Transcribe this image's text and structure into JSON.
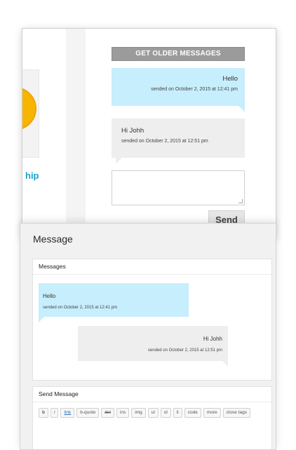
{
  "frontend": {
    "widget_link": "hip",
    "older_button": "GET OLDER MESSAGES",
    "messages": [
      {
        "text": "Hello",
        "meta": "sended on October 2, 2015 at 12:41 pm"
      },
      {
        "text": "Hi Johh",
        "meta": "sended on October 2, 2015 at 12:51 pm"
      }
    ],
    "send_button": "Send"
  },
  "admin": {
    "title": "Message",
    "messages_panel": {
      "heading": "Messages",
      "messages": [
        {
          "text": "Hello",
          "meta": "sended on October 2, 2015 at 12:41 pm"
        },
        {
          "text": "Hi Johh",
          "meta": "sended on October 2, 2015 at 12:51 pm"
        }
      ]
    },
    "send_panel": {
      "heading": "Send Message",
      "toolbar": [
        "b",
        "i",
        "link",
        "b-quote",
        "del",
        "ins",
        "img",
        "ul",
        "ol",
        "li",
        "code",
        "more",
        "close tags"
      ]
    }
  },
  "colors": {
    "sent_bubble": "#c7eefc",
    "received_bubble": "#eeeeee",
    "older_button": "#9b9b9b",
    "widget_circle": "#f7b500",
    "link": "#1ba0c8"
  }
}
